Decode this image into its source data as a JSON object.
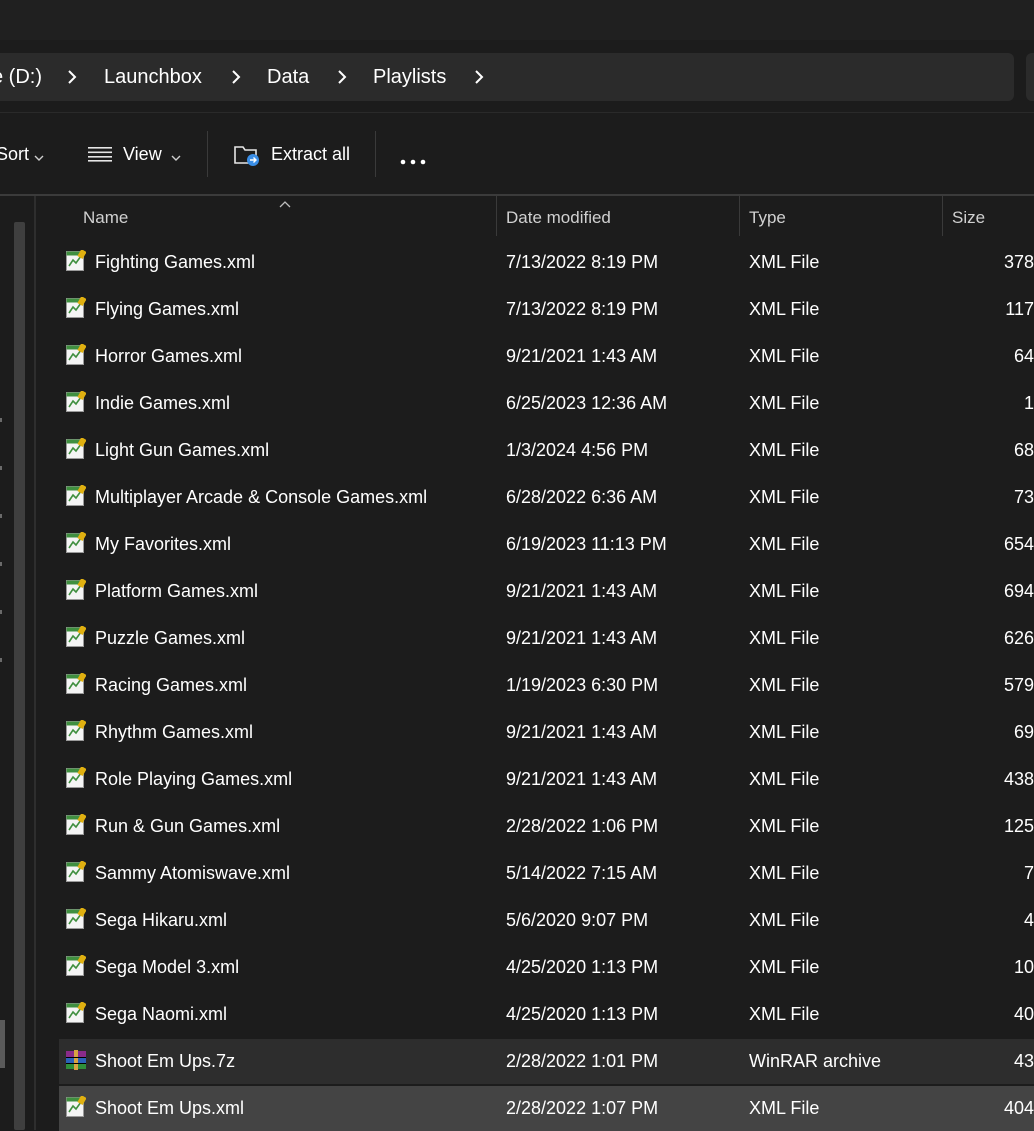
{
  "address": {
    "crumbs": [
      "e (D:)",
      "Launchbox",
      "Data",
      "Playlists"
    ]
  },
  "toolbar": {
    "sort_label": "Sort",
    "view_label": "View",
    "extract_label": "Extract all"
  },
  "columns": {
    "name": "Name",
    "date": "Date modified",
    "type": "Type",
    "size": "Size"
  },
  "files": [
    {
      "name": "Fighting Games.xml",
      "date": "7/13/2022 8:19 PM",
      "type": "XML File",
      "size": "378",
      "icon": "xml-file-icon"
    },
    {
      "name": "Flying Games.xml",
      "date": "7/13/2022 8:19 PM",
      "type": "XML File",
      "size": "117",
      "icon": "xml-file-icon"
    },
    {
      "name": "Horror Games.xml",
      "date": "9/21/2021 1:43 AM",
      "type": "XML File",
      "size": "64",
      "icon": "xml-file-icon"
    },
    {
      "name": "Indie Games.xml",
      "date": "6/25/2023 12:36 AM",
      "type": "XML File",
      "size": "1",
      "icon": "xml-file-icon"
    },
    {
      "name": "Light Gun Games.xml",
      "date": "1/3/2024 4:56 PM",
      "type": "XML File",
      "size": "68",
      "icon": "xml-file-icon"
    },
    {
      "name": "Multiplayer Arcade & Console Games.xml",
      "date": "6/28/2022 6:36 AM",
      "type": "XML File",
      "size": "73",
      "icon": "xml-file-icon"
    },
    {
      "name": "My Favorites.xml",
      "date": "6/19/2023 11:13 PM",
      "type": "XML File",
      "size": "654",
      "icon": "xml-file-icon"
    },
    {
      "name": "Platform Games.xml",
      "date": "9/21/2021 1:43 AM",
      "type": "XML File",
      "size": "694",
      "icon": "xml-file-icon"
    },
    {
      "name": "Puzzle Games.xml",
      "date": "9/21/2021 1:43 AM",
      "type": "XML File",
      "size": "626",
      "icon": "xml-file-icon"
    },
    {
      "name": "Racing Games.xml",
      "date": "1/19/2023 6:30 PM",
      "type": "XML File",
      "size": "579",
      "icon": "xml-file-icon"
    },
    {
      "name": "Rhythm Games.xml",
      "date": "9/21/2021 1:43 AM",
      "type": "XML File",
      "size": "69",
      "icon": "xml-file-icon"
    },
    {
      "name": "Role Playing Games.xml",
      "date": "9/21/2021 1:43 AM",
      "type": "XML File",
      "size": "438",
      "icon": "xml-file-icon"
    },
    {
      "name": "Run & Gun Games.xml",
      "date": "2/28/2022 1:06 PM",
      "type": "XML File",
      "size": "125",
      "icon": "xml-file-icon"
    },
    {
      "name": "Sammy Atomiswave.xml",
      "date": "5/14/2022 7:15 AM",
      "type": "XML File",
      "size": "7",
      "icon": "xml-file-icon"
    },
    {
      "name": "Sega Hikaru.xml",
      "date": "5/6/2020 9:07 PM",
      "type": "XML File",
      "size": "4",
      "icon": "xml-file-icon"
    },
    {
      "name": "Sega Model 3.xml",
      "date": "4/25/2020 1:13 PM",
      "type": "XML File",
      "size": "10",
      "icon": "xml-file-icon"
    },
    {
      "name": "Sega Naomi.xml",
      "date": "4/25/2020 1:13 PM",
      "type": "XML File",
      "size": "40",
      "icon": "xml-file-icon"
    },
    {
      "name": "Shoot Em Ups.7z",
      "date": "2/28/2022 1:01 PM",
      "type": "WinRAR archive",
      "size": "43",
      "icon": "winrar-archive-icon",
      "state": "selected"
    },
    {
      "name": "Shoot Em Ups.xml",
      "date": "2/28/2022 1:07 PM",
      "type": "XML File",
      "size": "404",
      "icon": "xml-file-icon",
      "state": "focused"
    }
  ]
}
